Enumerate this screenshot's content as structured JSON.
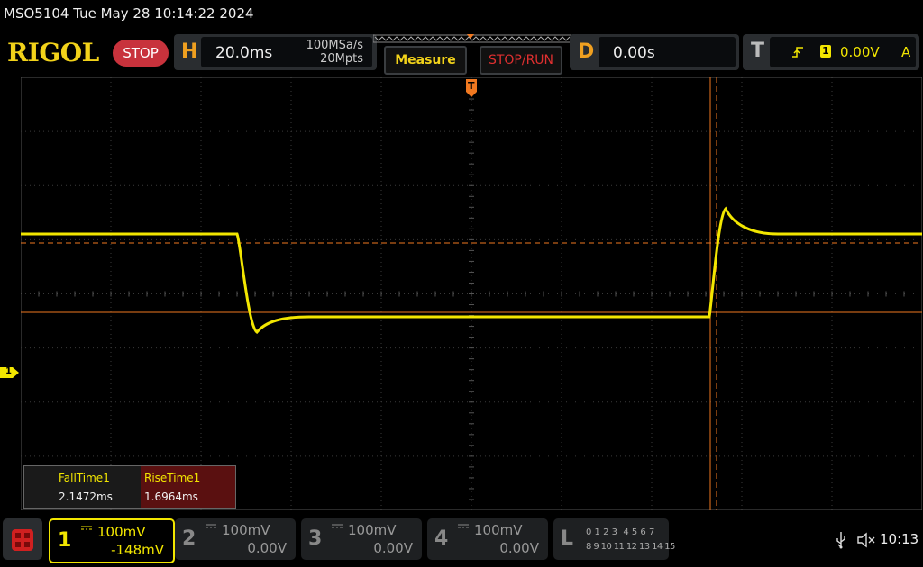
{
  "titlebar": {
    "text": "MSO5104  Tue May 28 10:14:22 2024"
  },
  "logo": "RIGOL",
  "run_state": "STOP",
  "horizontal": {
    "letter": "H",
    "timebase": "20.0ms",
    "sample_rate": "100MSa/s",
    "memory_depth": "20Mpts"
  },
  "buttons": {
    "measure": "Measure",
    "stop_run": "STOP/RUN"
  },
  "delay": {
    "letter": "D",
    "value": "0.00s"
  },
  "trigger": {
    "letter": "T",
    "channel": "1",
    "level": "0.00V",
    "mode": "A"
  },
  "trigger_pos_marker": "T",
  "channel1_marker": "1",
  "measurements": [
    {
      "label": "FallTime1",
      "value": "2.1472ms"
    },
    {
      "label": "RiseTime1",
      "value": "1.6964ms"
    }
  ],
  "channels": [
    {
      "num": "1",
      "scale": "100mV",
      "offset": "-148mV",
      "color": "#f2e600",
      "active": true
    },
    {
      "num": "2",
      "scale": "100mV",
      "offset": "0.00V",
      "color": "#888888",
      "active": false
    },
    {
      "num": "3",
      "scale": "100mV",
      "offset": "0.00V",
      "color": "#888888",
      "active": false
    },
    {
      "num": "4",
      "scale": "100mV",
      "offset": "0.00V",
      "color": "#888888",
      "active": false
    }
  ],
  "logic": {
    "letter": "L",
    "row1": "0 1 2 3  4 5 6 7",
    "row2": "8 9 10 11 12 13 14 15"
  },
  "status": {
    "time": "10:13"
  },
  "colors": {
    "ch1": "#f2e600",
    "cursor": "#f07820",
    "accent": "#f0a020"
  }
}
